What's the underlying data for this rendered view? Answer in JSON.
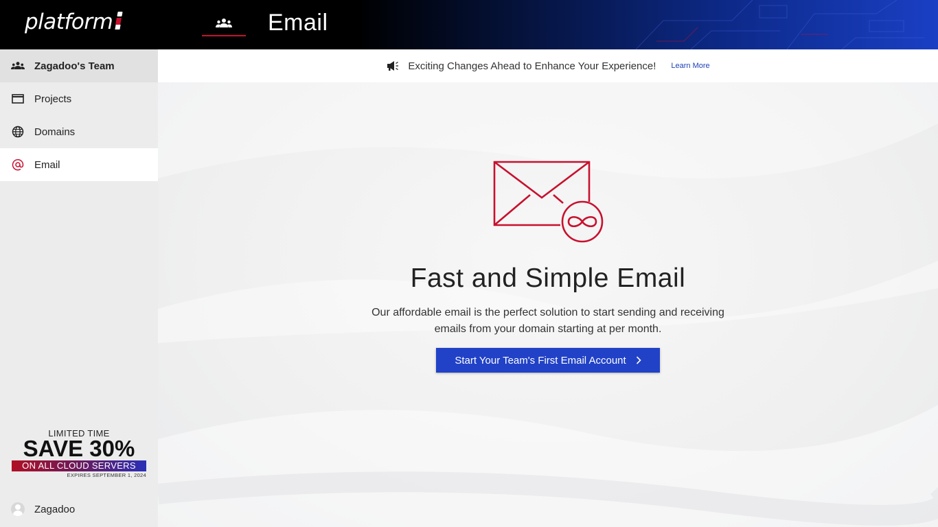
{
  "header": {
    "logo_text": "platform",
    "logo_mark": "i",
    "team_switch_icon": "team-icon",
    "page_title": "Email"
  },
  "sidebar": {
    "items": [
      {
        "label": "Zagadoo's Team",
        "icon": "team-icon"
      },
      {
        "label": "Projects",
        "icon": "window-icon"
      },
      {
        "label": "Domains",
        "icon": "globe-icon"
      },
      {
        "label": "Email",
        "icon": "at-sign-icon",
        "active": true
      }
    ],
    "promo": {
      "line1": "LIMITED TIME",
      "line2": "SAVE 30%",
      "line3": "ON ALL CLOUD SERVERS",
      "line4": "EXPIRES SEPTEMBER 1, 2024"
    },
    "user": {
      "name": "Zagadoo"
    }
  },
  "announcement": {
    "icon": "megaphone-icon",
    "message": "Exciting Changes Ahead to Enhance Your Experience!",
    "link": "Learn More"
  },
  "main": {
    "icon": "email-infinity-icon",
    "title": "Fast and Simple Email",
    "description": "Our affordable email is the perfect solution to start sending and receiving emails from your domain starting at per month.",
    "cta_label": "Start Your Team's First Email Account"
  },
  "colors": {
    "accent_red": "#c8102e",
    "button_blue": "#2142c7",
    "link_blue": "#1e3fb8"
  }
}
